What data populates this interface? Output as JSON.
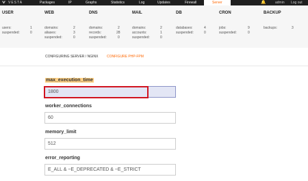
{
  "topnav": {
    "logo": "VESTA",
    "items": [
      "Packages",
      "IP",
      "Graphs",
      "Statistics",
      "Log",
      "Updates",
      "Firewall",
      "Server"
    ],
    "active": "Server",
    "username": "admin",
    "logout": "Log out"
  },
  "stats": {
    "user": {
      "title": "USER",
      "rows": [
        [
          "users:",
          "1"
        ],
        [
          "suspended:",
          "0"
        ]
      ]
    },
    "web": {
      "title": "WEB",
      "rows": [
        [
          "domains:",
          "2"
        ],
        [
          "aliases:",
          "3"
        ],
        [
          "suspended:",
          "0"
        ]
      ]
    },
    "dns": {
      "title": "DNS",
      "rows": [
        [
          "domains:",
          "2"
        ],
        [
          "records:",
          "28"
        ],
        [
          "suspended:",
          "0"
        ]
      ]
    },
    "mail": {
      "title": "MAIL",
      "rows": [
        [
          "domains:",
          "2"
        ],
        [
          "accounts:",
          "1"
        ],
        [
          "suspended:",
          "0"
        ]
      ]
    },
    "db": {
      "title": "DB",
      "rows": [
        [
          "databases:",
          "4"
        ],
        [
          "suspended:",
          "0"
        ]
      ]
    },
    "cron": {
      "title": "CRON",
      "rows": [
        [
          "jobs:",
          "9"
        ],
        [
          "suspended:",
          "0"
        ]
      ]
    },
    "backup": {
      "title": "BACKUP",
      "rows": [
        [
          "backups:",
          "3"
        ]
      ]
    }
  },
  "subtabs": {
    "first": "CONFIGURING SERVER / NGINX",
    "second": "CONFIGURE PHP-FPM"
  },
  "fields": [
    {
      "label": "max_execution_time",
      "value": "1800"
    },
    {
      "label": "worker_connections",
      "value": "60"
    },
    {
      "label": "memory_limit",
      "value": "512"
    },
    {
      "label": "error_reporting",
      "value": "E_ALL & ~E_DEPRECATED & ~E_STRICT"
    }
  ],
  "colors": {
    "accent": "#ff6701",
    "highlight": "#ffd084",
    "red_box": "#d1131f",
    "active_field": "#e3e6f5"
  }
}
